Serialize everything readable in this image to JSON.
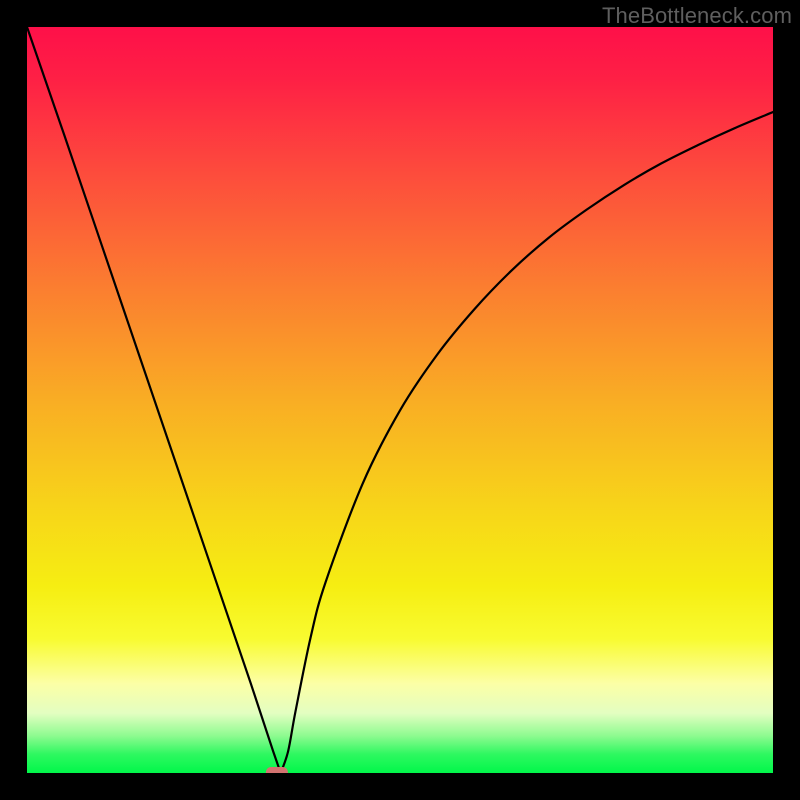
{
  "attribution": "TheBottleneck.com",
  "chart_data": {
    "type": "line",
    "title": "",
    "xlabel": "",
    "ylabel": "",
    "xlim": [
      0,
      100
    ],
    "ylim": [
      0,
      100
    ],
    "grid": false,
    "legend": false,
    "note": "Values are arbitrary units read from pixel geometry; the curve is a V-shaped bottleneck function with its minimum near x≈34. Axes have no tick labels.",
    "x": [
      0,
      5,
      10,
      15,
      20,
      25,
      30,
      33,
      34,
      35,
      36,
      38,
      40,
      45,
      50,
      55,
      60,
      65,
      70,
      75,
      80,
      85,
      90,
      95,
      100
    ],
    "values": [
      100,
      85.5,
      70.8,
      56.1,
      41.4,
      26.7,
      12.0,
      2.9,
      0.0,
      2.9,
      8.3,
      18.1,
      25.5,
      38.8,
      48.6,
      56.1,
      62.2,
      67.4,
      71.8,
      75.5,
      78.8,
      81.7,
      84.2,
      86.5,
      88.6
    ],
    "minimum": {
      "x": 34,
      "y": 0
    },
    "marker": {
      "shape": "pill",
      "x": 33.5,
      "y": 0.0,
      "color": "#d27370"
    },
    "background_gradient": {
      "stops": [
        {
          "offset": 0.0,
          "color": "#fe1049"
        },
        {
          "offset": 0.07,
          "color": "#fe2045"
        },
        {
          "offset": 0.2,
          "color": "#fd4d3c"
        },
        {
          "offset": 0.35,
          "color": "#fb7e30"
        },
        {
          "offset": 0.5,
          "color": "#f9ad24"
        },
        {
          "offset": 0.65,
          "color": "#f7d619"
        },
        {
          "offset": 0.75,
          "color": "#f6ee12"
        },
        {
          "offset": 0.82,
          "color": "#f8fb30"
        },
        {
          "offset": 0.88,
          "color": "#fcffa6"
        },
        {
          "offset": 0.92,
          "color": "#e3fec1"
        },
        {
          "offset": 0.95,
          "color": "#8efb90"
        },
        {
          "offset": 0.975,
          "color": "#2ef860"
        },
        {
          "offset": 1.0,
          "color": "#01f74a"
        }
      ]
    }
  }
}
